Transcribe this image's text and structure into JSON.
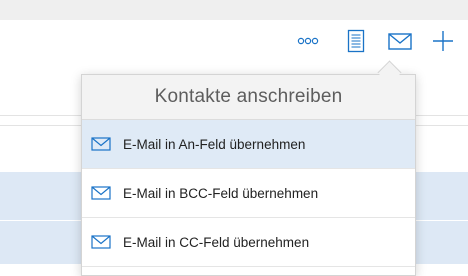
{
  "toolbar": {
    "icons": [
      {
        "name": "more-options-icon"
      },
      {
        "name": "document-icon"
      },
      {
        "name": "mail-icon"
      },
      {
        "name": "add-icon"
      }
    ]
  },
  "popover": {
    "title": "Kontakte anschreiben",
    "items": [
      {
        "label": "E-Mail in An-Feld übernehmen",
        "selected": true
      },
      {
        "label": "E-Mail in BCC-Feld übernehmen",
        "selected": false
      },
      {
        "label": "E-Mail in CC-Feld übernehmen",
        "selected": false
      }
    ]
  },
  "colors": {
    "accent": "#1a73c7",
    "selected_row": "#dfeaf6",
    "header_bg": "#f3f3f3"
  }
}
